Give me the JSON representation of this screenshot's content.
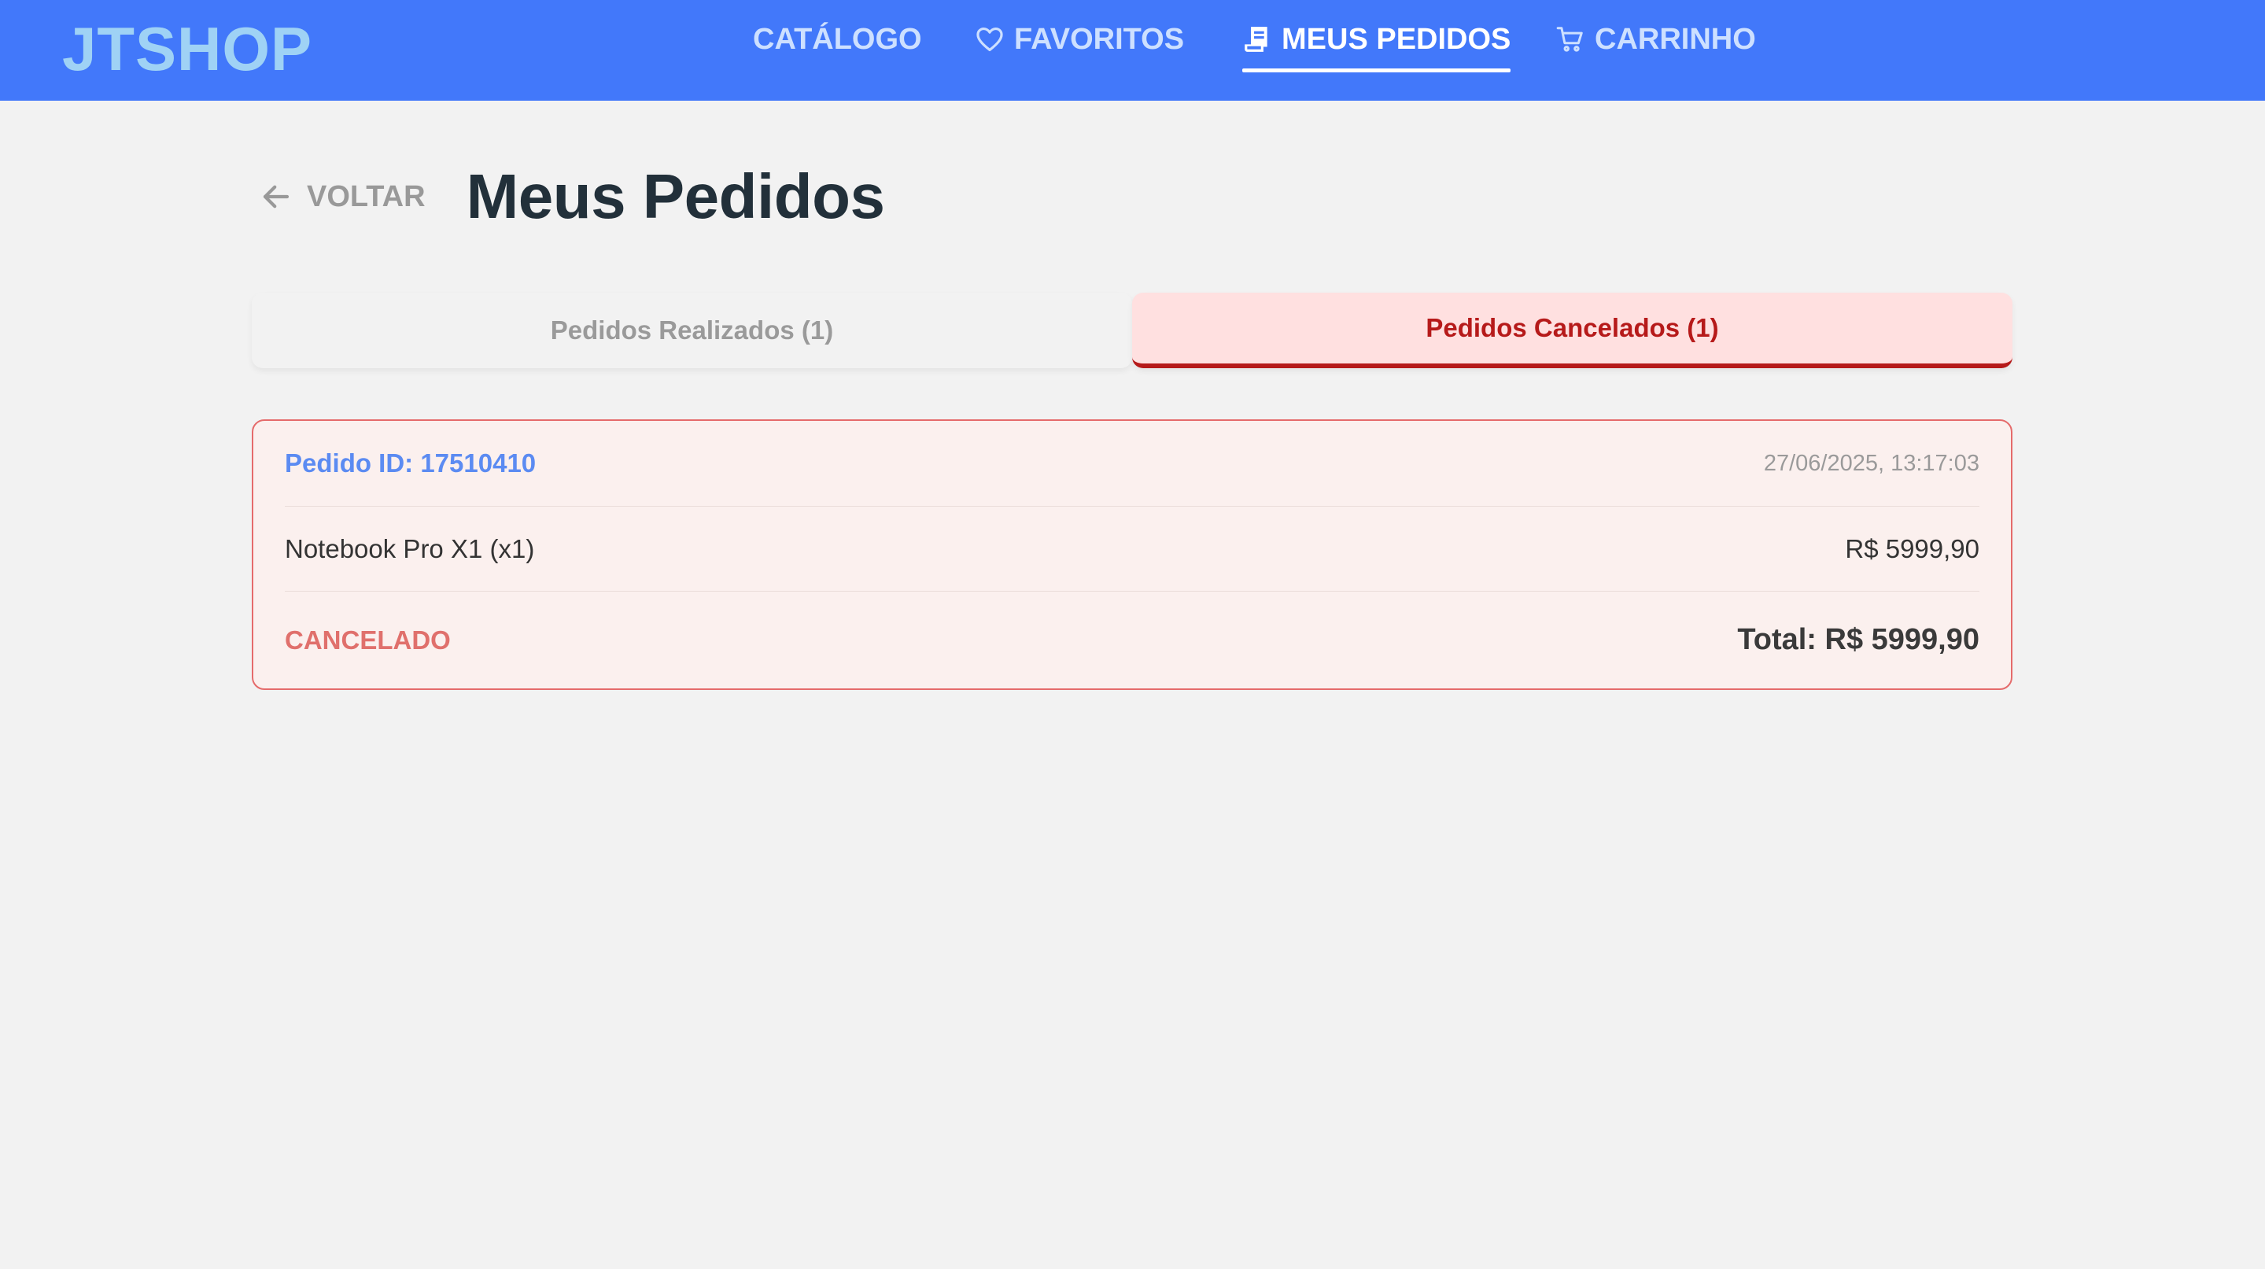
{
  "brand": "JTSHOP",
  "nav": {
    "catalog": {
      "label": "CATÁLOGO"
    },
    "favorites": {
      "label": "FAVORITOS",
      "icon": "heart-icon"
    },
    "orders": {
      "label": "MEUS PEDIDOS",
      "icon": "receipt-icon",
      "active": true
    },
    "cart": {
      "label": "CARRINHO",
      "icon": "cart-icon"
    }
  },
  "page": {
    "back_label": "VOLTAR",
    "back_icon": "arrow-left-icon",
    "title": "Meus Pedidos"
  },
  "tabs": [
    {
      "label": "Pedidos Realizados (1)",
      "active": false
    },
    {
      "label": "Pedidos Cancelados (1)",
      "active": true
    }
  ],
  "order": {
    "id_label": "Pedido ID: 17510410",
    "date": "27/06/2025, 13:17:03",
    "items": [
      {
        "name": "Notebook Pro X1 (x1)",
        "price": "R$ 5999,90"
      }
    ],
    "status": "CANCELADO",
    "total": "Total: R$ 5999,90"
  },
  "colors": {
    "header_bg": "#4278fa",
    "logo": "#9fd2f5",
    "cancel_accent": "#b61a1a",
    "order_id": "#5b8bf2",
    "status_cancelled": "#e0706c"
  }
}
